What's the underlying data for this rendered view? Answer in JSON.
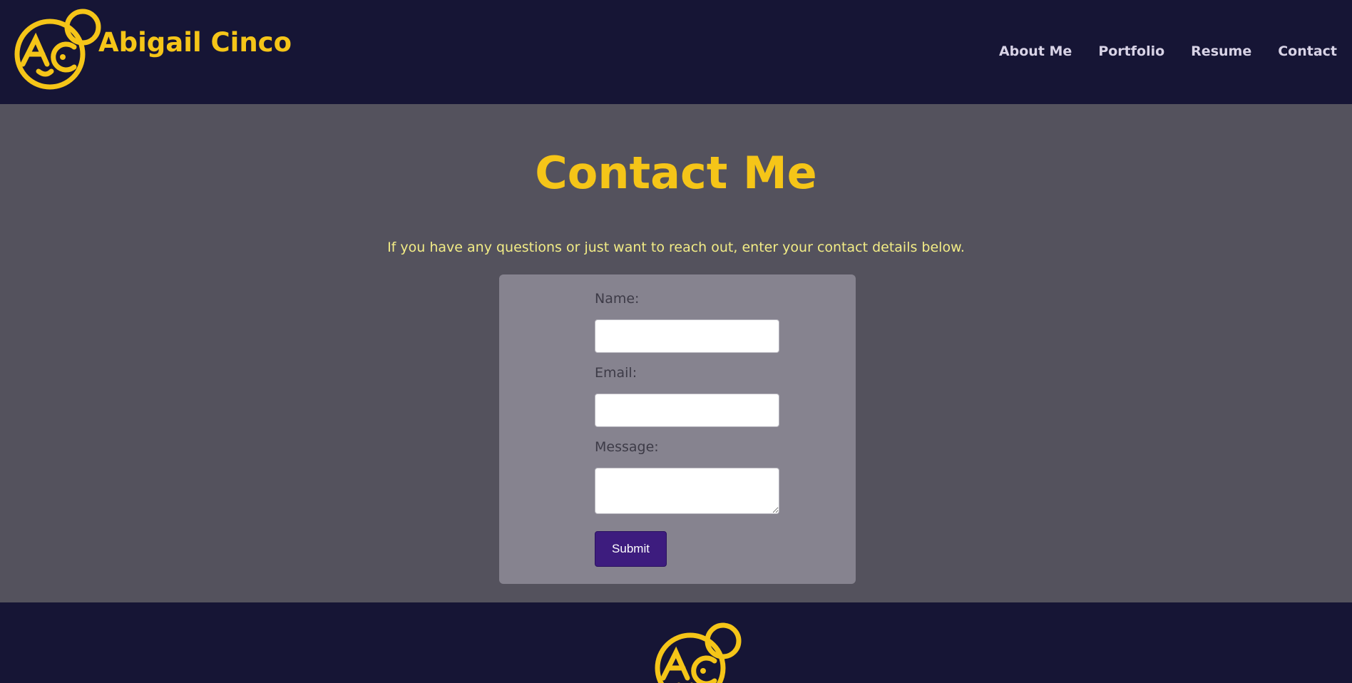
{
  "header": {
    "brand_name": "Abigail Cinco",
    "logo_icon": "ac-monogram-logo",
    "nav": [
      {
        "label": "About Me"
      },
      {
        "label": "Portfolio"
      },
      {
        "label": "Resume"
      },
      {
        "label": "Contact"
      }
    ]
  },
  "main": {
    "title": "Contact Me",
    "intro": "If you have any questions or just want to reach out, enter your contact details below.",
    "form": {
      "name_label": "Name:",
      "name_value": "",
      "email_label": "Email:",
      "email_value": "",
      "message_label": "Message:",
      "message_value": "",
      "submit_label": "Submit"
    }
  },
  "footer": {
    "logo_icon": "ac-monogram-logo"
  },
  "colors": {
    "header_bg": "#161535",
    "main_bg": "#54525d",
    "card_bg": "#86838f",
    "accent_yellow": "#f5c518",
    "intro_text": "#f2ec86",
    "nav_text": "#d8d3e6",
    "button_bg": "#3d1c7e"
  }
}
